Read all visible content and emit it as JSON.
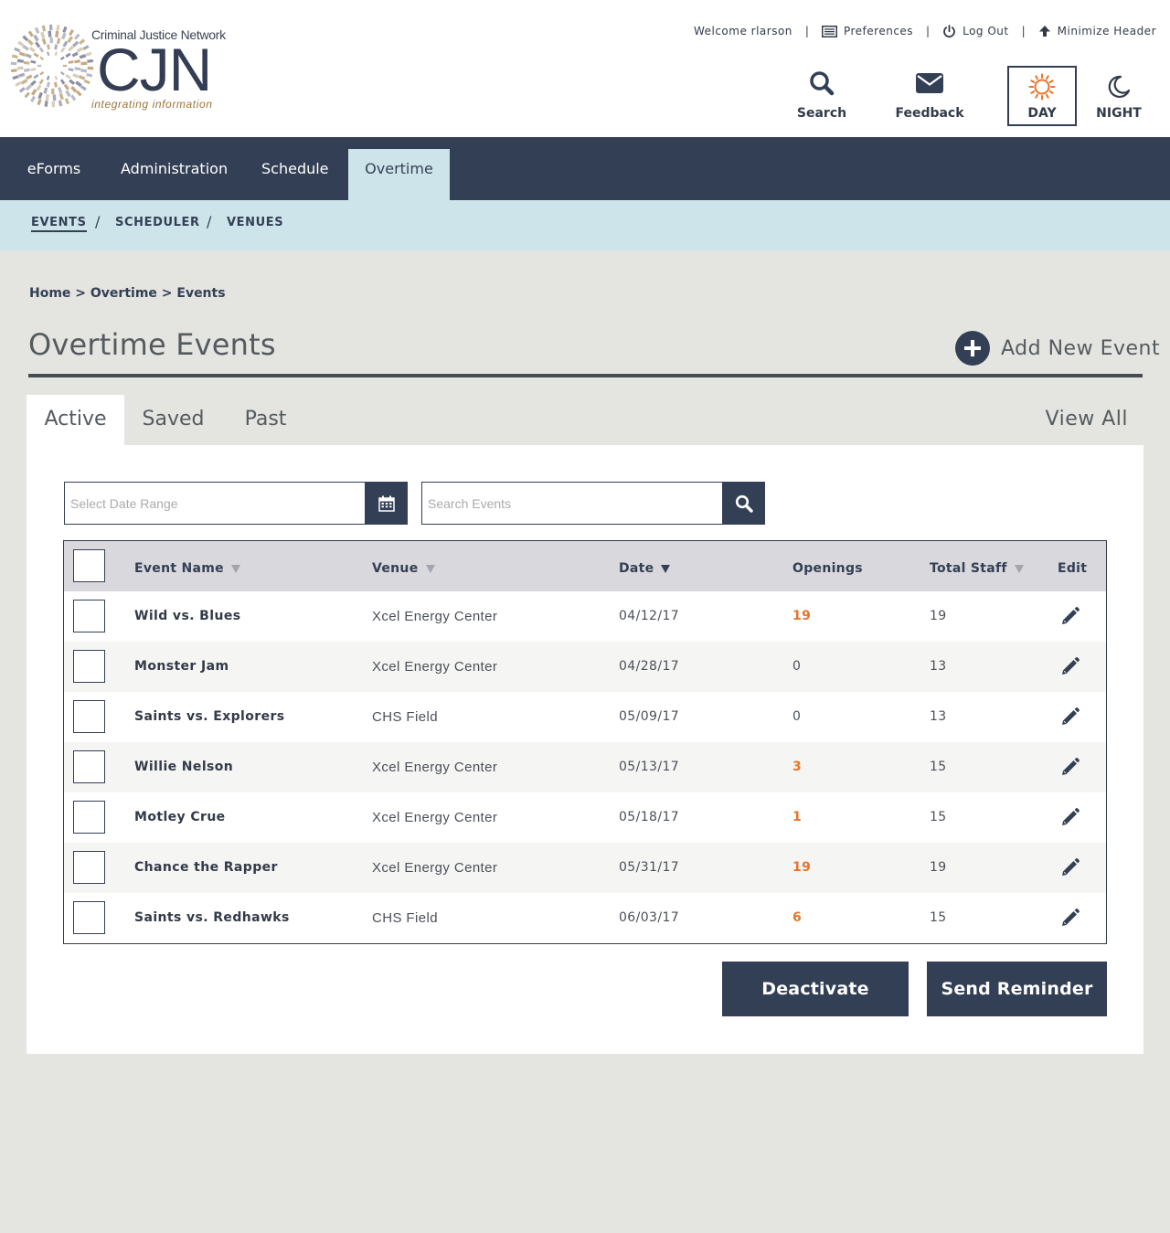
{
  "brand": {
    "org_name": "Criminal Justice Network",
    "mark": "CJN",
    "tagline": "integrating information"
  },
  "utility": {
    "welcome": "Welcome rlarson",
    "preferences": "Preferences",
    "logout": "Log Out",
    "minimize": "Minimize Header"
  },
  "header_actions": {
    "search": "Search",
    "feedback": "Feedback",
    "day": "DAY",
    "night": "NIGHT"
  },
  "main_nav": [
    {
      "label": "eForms",
      "active": false
    },
    {
      "label": "Administration",
      "active": false
    },
    {
      "label": "Schedule",
      "active": false
    },
    {
      "label": "Overtime",
      "active": true
    }
  ],
  "sub_nav": [
    {
      "label": "EVENTS",
      "active": true
    },
    {
      "label": "SCHEDULER",
      "active": false
    },
    {
      "label": "VENUES",
      "active": false
    }
  ],
  "breadcrumb": "Home > Overtime > Events",
  "page_title": "Overtime Events",
  "add_event": "Add New Event",
  "tabs": [
    {
      "label": "Active",
      "active": true
    },
    {
      "label": "Saved",
      "active": false
    },
    {
      "label": "Past",
      "active": false
    }
  ],
  "view_all": "View All",
  "filters": {
    "date_placeholder": "Select Date Range",
    "search_placeholder": "Search Events"
  },
  "table": {
    "columns": [
      "Event Name",
      "Venue",
      "Date",
      "Openings",
      "Total Staff",
      "Edit"
    ],
    "rows": [
      {
        "name": "Wild vs. Blues",
        "venue": "Xcel Energy Center",
        "date": "04/12/17",
        "openings": "19",
        "staff": "19"
      },
      {
        "name": "Monster Jam",
        "venue": "Xcel Energy Center",
        "date": "04/28/17",
        "openings": "0",
        "staff": "13"
      },
      {
        "name": "Saints vs. Explorers",
        "venue": "CHS Field",
        "date": "05/09/17",
        "openings": "0",
        "staff": "13"
      },
      {
        "name": "Willie Nelson",
        "venue": "Xcel Energy Center",
        "date": "05/13/17",
        "openings": "3",
        "staff": "15"
      },
      {
        "name": "Motley Crue",
        "venue": "Xcel Energy Center",
        "date": "05/18/17",
        "openings": "1",
        "staff": "15"
      },
      {
        "name": "Chance the Rapper",
        "venue": "Xcel Energy Center",
        "date": "05/31/17",
        "openings": "19",
        "staff": "19"
      },
      {
        "name": "Saints vs. Redhawks",
        "venue": "CHS Field",
        "date": "06/03/17",
        "openings": "6",
        "staff": "15"
      }
    ]
  },
  "actions": {
    "deactivate": "Deactivate",
    "reminder": "Send Reminder"
  },
  "colors": {
    "navy": "#333f55",
    "accent_orange": "#e8742a",
    "light_blue": "#cde4ea",
    "page_bg": "#e4e5e1"
  }
}
